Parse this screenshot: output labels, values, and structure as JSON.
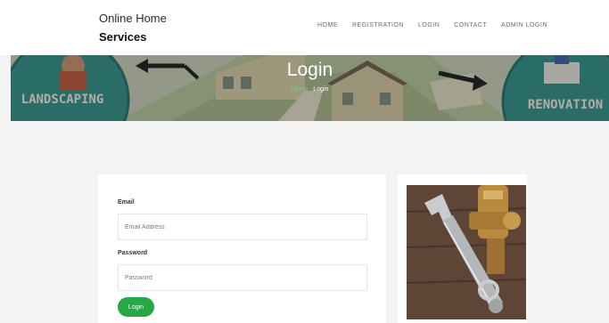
{
  "brand": {
    "line1": "Online Home",
    "line2": "Services"
  },
  "nav": {
    "items": [
      {
        "label": "HOME"
      },
      {
        "label": "REGISTRATION"
      },
      {
        "label": "LOGIN"
      },
      {
        "label": "CONTACT"
      },
      {
        "label": "ADMIN LOGIN"
      }
    ]
  },
  "banner": {
    "title": "Login",
    "breadcrumb_home": "Home",
    "breadcrumb_current": "Login",
    "left_badge": "LANDSCAPING",
    "right_badge": "RENOVATION"
  },
  "form": {
    "email_label": "Email",
    "email_placeholder": "Email Address",
    "password_label": "Password",
    "password_placeholder": "Password",
    "submit_label": "Login"
  },
  "colors": {
    "accent_green": "#28a745",
    "breadcrumb_home": "#6bd08d",
    "badge_teal": "#2f8f8a"
  }
}
